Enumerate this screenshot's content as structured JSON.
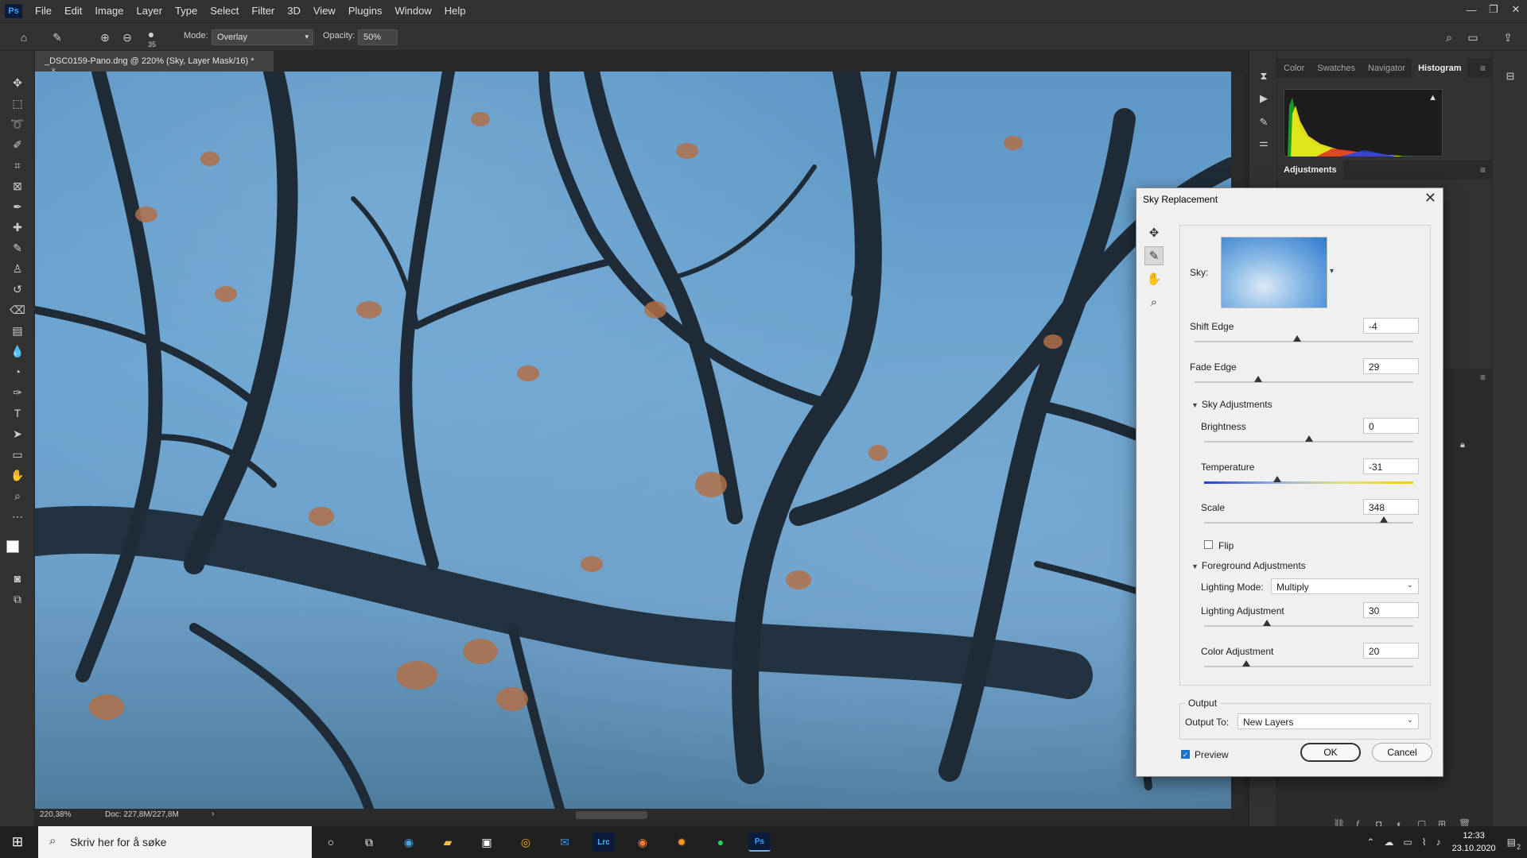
{
  "app": {
    "menu": [
      "File",
      "Edit",
      "Image",
      "Layer",
      "Type",
      "Select",
      "Filter",
      "3D",
      "View",
      "Plugins",
      "Window",
      "Help"
    ],
    "logo": "Ps",
    "window_controls": {
      "minimize": "—",
      "restore": "❐",
      "close": "✕"
    }
  },
  "options": {
    "brush_size": "35",
    "mode_label": "Mode:",
    "mode_value": "Overlay",
    "opacity_label": "Opacity:",
    "opacity_value": "50%"
  },
  "document": {
    "tab_title": "_DSC0159-Pano.dng @ 220% (Sky, Layer Mask/16) *",
    "tab_close": "×",
    "zoom": "220,38%",
    "doc_size": "Doc: 227,8M/227,8M"
  },
  "panels": {
    "top_tabs": [
      "Color",
      "Swatches",
      "Navigator",
      "Histogram"
    ],
    "active_top_tab": "Histogram",
    "adjustments_tab": "Adjustments"
  },
  "dialog": {
    "title": "Sky Replacement",
    "close": "✕",
    "sky_label": "Sky:",
    "shift_edge": {
      "label": "Shift Edge",
      "value": "-4",
      "slider": 0.47
    },
    "fade_edge": {
      "label": "Fade Edge",
      "value": "29",
      "slider": 0.29
    },
    "sky_adjustments": {
      "title": "Sky Adjustments",
      "brightness": {
        "label": "Brightness",
        "value": "0",
        "slider": 0.5
      },
      "temperature": {
        "label": "Temperature",
        "value": "-31",
        "slider": 0.35
      },
      "scale": {
        "label": "Scale",
        "value": "348",
        "slider": 0.86
      },
      "flip": {
        "label": "Flip",
        "checked": false
      }
    },
    "foreground_adjustments": {
      "title": "Foreground Adjustments",
      "lighting_mode_label": "Lighting Mode:",
      "lighting_mode_value": "Multiply",
      "lighting_adjustment": {
        "label": "Lighting Adjustment",
        "value": "30",
        "slider": 0.3
      },
      "color_adjustment": {
        "label": "Color Adjustment",
        "value": "20",
        "slider": 0.2
      }
    },
    "output": {
      "title": "Output",
      "output_to_label": "Output To:",
      "output_to_value": "New Layers"
    },
    "preview": {
      "label": "Preview",
      "checked": true
    },
    "ok": "OK",
    "cancel": "Cancel"
  },
  "taskbar": {
    "search_placeholder": "Skriv her for å søke",
    "time": "12:33",
    "date": "23.10.2020",
    "notification_count": "2"
  }
}
